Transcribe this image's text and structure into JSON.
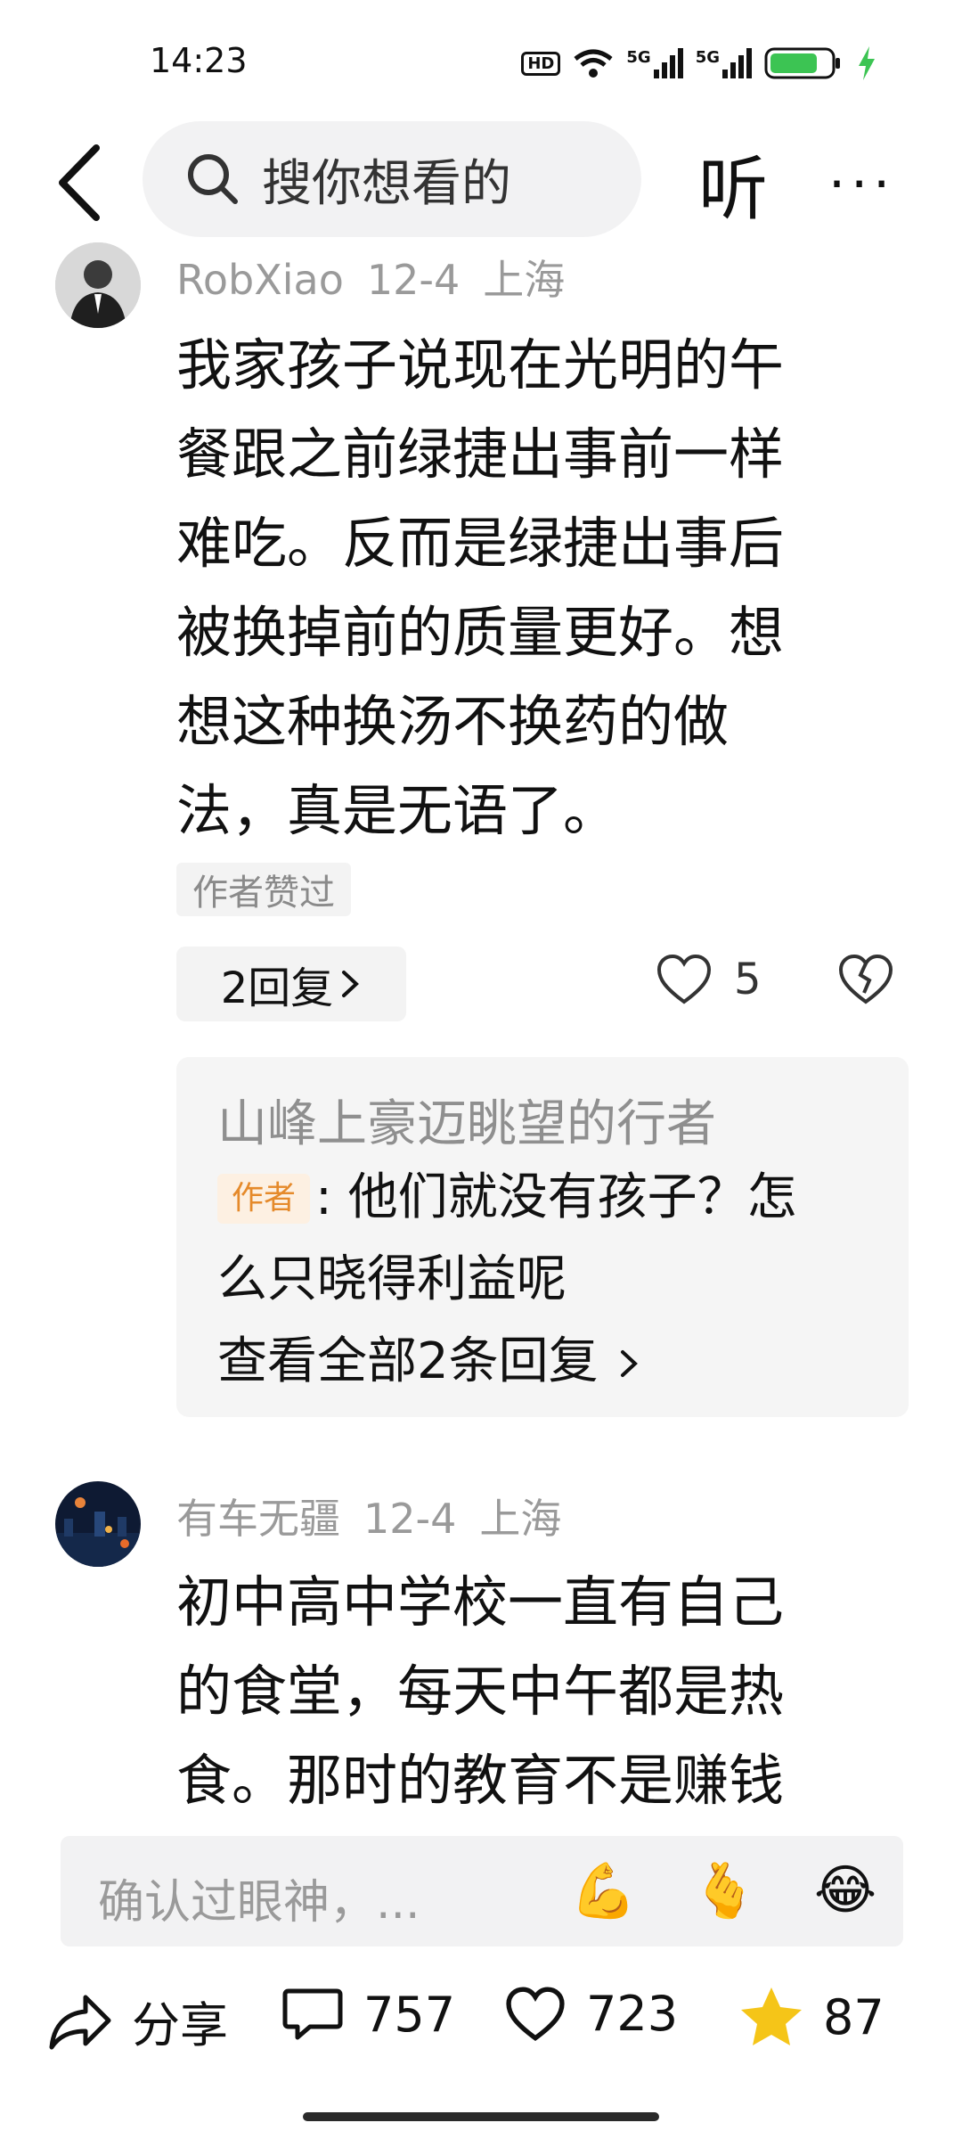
{
  "status_bar": {
    "time": "14:23",
    "hd": "HD",
    "net1": "5G",
    "net2": "5G"
  },
  "header": {
    "search_placeholder": "搜你想看的",
    "listen_label": "听",
    "more_label": "···"
  },
  "comments": [
    {
      "user": "RobXiao",
      "date": "12-4",
      "location": "上海",
      "lines": [
        "我家孩子说现在光明的午",
        "餐跟之前绿捷出事前一样",
        "难吃。反而是绿捷出事后",
        "被换掉前的质量更好。想",
        "想这种换汤不换药的做",
        "法，真是无语了。"
      ],
      "badge": "作者赞过",
      "reply_count_label": "2回复",
      "likes": "5",
      "reply_preview": {
        "author": "山峰上豪迈眺望的行者",
        "tag": "作者",
        "text_line1": ": 他们就没有孩子？怎",
        "text_line2": "么只晓得利益呢",
        "view_all": "查看全部2条回复"
      }
    },
    {
      "user": "有车无疆",
      "date": "12-4",
      "location": "上海",
      "lines": [
        "初中高中学校一直有自己",
        "的食堂，每天中午都是热",
        "食。那时的教育不是赚钱"
      ]
    }
  ],
  "input_bar": {
    "placeholder": "确认过眼神，...",
    "emojis": [
      "💪",
      "🫰",
      "😂"
    ]
  },
  "bottom_bar": {
    "share_label": "分享",
    "comments_count": "757",
    "likes_count": "723",
    "stars_count": "87"
  },
  "colors": {
    "star": "#f5c518",
    "battery": "#3cc453",
    "tag_author": "#e58a2b"
  }
}
